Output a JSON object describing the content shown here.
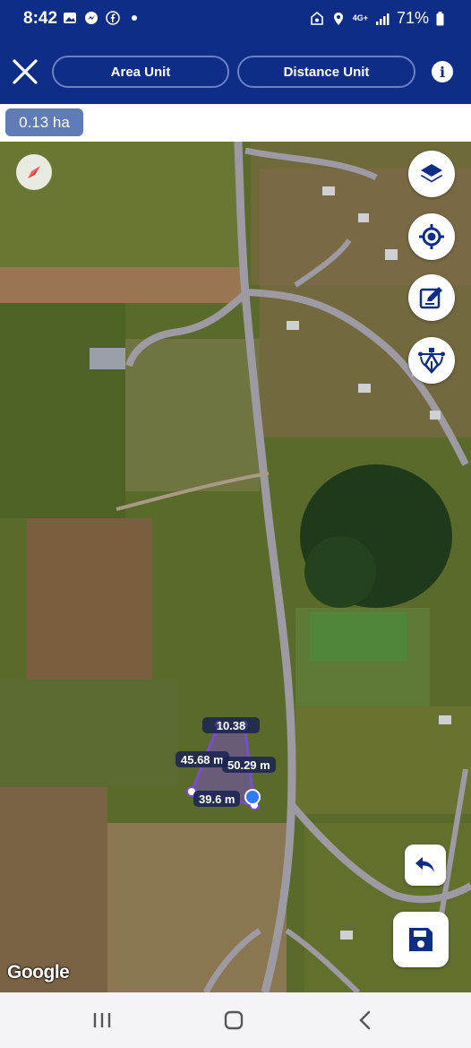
{
  "status_bar": {
    "time": "8:42",
    "network": "4G+",
    "battery": "71%",
    "icons_left": [
      "gallery-icon",
      "messenger-icon",
      "facebook-icon",
      "dot-icon"
    ],
    "icons_right": [
      "data-saver-icon",
      "location-icon",
      "signal-icon",
      "battery-icon"
    ]
  },
  "header": {
    "area_unit_label": "Area Unit",
    "distance_unit_label": "Distance Unit",
    "info_label": "i"
  },
  "area": {
    "value": "0.13 ha"
  },
  "map": {
    "attribution": "Google",
    "measurements": {
      "top": "10.38",
      "left": "45.68 m",
      "right": "50.29 m",
      "bottom": "39.6 m"
    },
    "polygon_color": "#7a4cd6",
    "active_vertex_color": "#2f7bff"
  },
  "colors": {
    "header_bg": "#0d2d86",
    "chip_bg": "#5f7bb8",
    "icon_blue": "#0d2d86"
  }
}
